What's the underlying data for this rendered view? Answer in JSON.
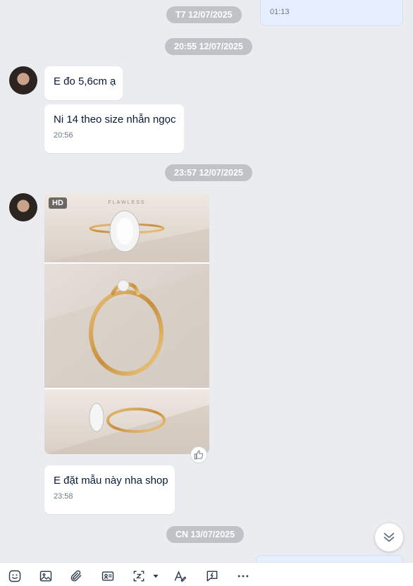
{
  "messages": {
    "top_out_time": "01:13",
    "stamp1": "T7 12/07/2025",
    "stamp2": "20:55 12/07/2025",
    "msg1_text": "E đo 5,6cm ạ",
    "msg2_text": "Ni 14 theo size nhẫn ngọc",
    "msg2_time": "20:56",
    "stamp3": "23:57 12/07/2025",
    "photo_badge": "HD",
    "photo_brand": "FLAWLESS",
    "msg3_text": "E đặt mẫu này nha shop",
    "msg3_time": "23:58",
    "stamp4": "CN 13/07/2025"
  },
  "toolbar": {
    "items": [
      "sticker-icon",
      "image-icon",
      "attachment-icon",
      "contact-card-icon",
      "screenshot-icon",
      "format-text-icon",
      "quick-message-icon",
      "more-icon"
    ]
  },
  "colors": {
    "background": "#ebecf0",
    "stamp": "#bfc2c7",
    "outgoing": "#e5efff",
    "incoming": "#ffffff"
  }
}
